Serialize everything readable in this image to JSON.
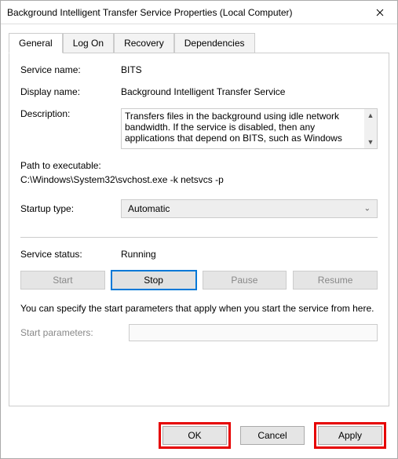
{
  "window": {
    "title": "Background Intelligent Transfer Service Properties (Local Computer)"
  },
  "tabs": {
    "general": "General",
    "logon": "Log On",
    "recovery": "Recovery",
    "dependencies": "Dependencies"
  },
  "general": {
    "service_name_label": "Service name:",
    "service_name": "BITS",
    "display_name_label": "Display name:",
    "display_name": "Background Intelligent Transfer Service",
    "description_label": "Description:",
    "description": "Transfers files in the background using idle network bandwidth. If the service is disabled, then any applications that depend on BITS, such as Windows",
    "path_label": "Path to executable:",
    "path_value": "C:\\Windows\\System32\\svchost.exe -k netsvcs -p",
    "startup_label": "Startup type:",
    "startup_value": "Automatic",
    "status_label": "Service status:",
    "status_value": "Running",
    "btn_start": "Start",
    "btn_stop": "Stop",
    "btn_pause": "Pause",
    "btn_resume": "Resume",
    "note": "You can specify the start parameters that apply when you start the service from here.",
    "start_params_label": "Start parameters:",
    "start_params_value": ""
  },
  "footer": {
    "ok": "OK",
    "cancel": "Cancel",
    "apply": "Apply"
  }
}
